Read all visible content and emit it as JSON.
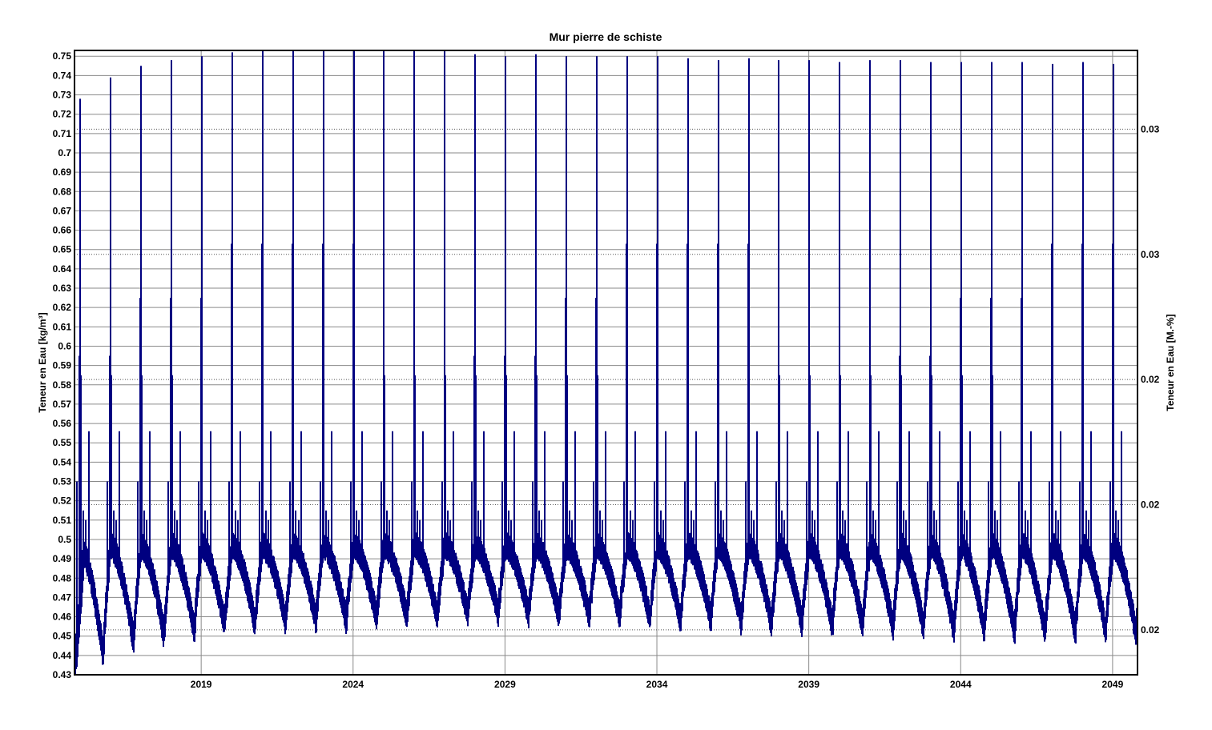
{
  "chart_data": {
    "type": "line",
    "title": "Mur pierre de schiste",
    "ylabel": "Teneur en Eau [kg/m³]",
    "ylabel_right": "Teneur en Eau [M.-%]",
    "xlabel": "",
    "xlim": [
      2014.83,
      2049.82
    ],
    "ylim": [
      0.43,
      0.753
    ],
    "grid": true,
    "series_color": "#000080",
    "x_ticks": [
      2019,
      2024,
      2029,
      2034,
      2039,
      2044,
      2049
    ],
    "y_ticks": [
      0.43,
      0.44,
      0.45,
      0.46,
      0.47,
      0.48,
      0.49,
      0.5,
      0.51,
      0.52,
      0.53,
      0.54,
      0.55,
      0.56,
      0.57,
      0.58,
      0.59,
      0.6,
      0.61,
      0.62,
      0.63,
      0.64,
      0.65,
      0.66,
      0.67,
      0.68,
      0.69,
      0.7,
      0.71,
      0.72,
      0.73,
      0.74,
      0.75
    ],
    "y_tick_labels": [
      "0.43",
      "0.44",
      "0.45",
      "0.46",
      "0.47",
      "0.48",
      "0.49",
      "0.5",
      "0.51",
      "0.52",
      "0.53",
      "0.54",
      "0.55",
      "0.56",
      "0.57",
      "0.58",
      "0.59",
      "0.6",
      "0.61",
      "0.62",
      "0.63",
      "0.64",
      "0.65",
      "0.66",
      "0.67",
      "0.68",
      "0.69",
      "0.7",
      "0.71",
      "0.72",
      "0.73",
      "0.74",
      "0.75"
    ],
    "right_axis": {
      "kgm3_per_mpercent": 25.9,
      "ticks": [
        0.0175,
        0.02,
        0.0225,
        0.025,
        0.0275
      ],
      "labels": [
        "0.02",
        "0.02",
        "0.02",
        "0.03",
        "0.03"
      ]
    },
    "series": [
      {
        "name": "Teneur en Eau",
        "start_value": 0.43,
        "annual_peak_years": [
          2015,
          2016,
          2017,
          2018,
          2019,
          2020,
          2021,
          2022,
          2023,
          2024,
          2025,
          2026,
          2027,
          2028,
          2029,
          2030,
          2031,
          2032,
          2033,
          2034,
          2035,
          2036,
          2037,
          2038,
          2039,
          2040,
          2041,
          2042,
          2043,
          2044,
          2045,
          2046,
          2047,
          2048,
          2049
        ],
        "annual_peak_values": [
          0.728,
          0.739,
          0.745,
          0.748,
          0.75,
          0.752,
          0.753,
          0.753,
          0.753,
          0.753,
          0.753,
          0.753,
          0.753,
          0.751,
          0.75,
          0.751,
          0.75,
          0.75,
          0.75,
          0.75,
          0.749,
          0.748,
          0.749,
          0.748,
          0.748,
          0.747,
          0.748,
          0.748,
          0.747,
          0.747,
          0.747,
          0.747,
          0.746,
          0.747,
          0.746
        ],
        "secondary_peak_value": 0.653,
        "winter_plateau_value": 0.497,
        "annual_min_years": [
          2015,
          2016,
          2017,
          2018,
          2019,
          2020,
          2021,
          2022,
          2023,
          2024,
          2025,
          2026,
          2027,
          2028,
          2029,
          2030,
          2031,
          2032,
          2033,
          2034,
          2035,
          2036,
          2037,
          2038,
          2039,
          2040,
          2041,
          2042,
          2043,
          2044,
          2045,
          2046,
          2047,
          2048,
          2049
        ],
        "annual_min_values": [
          0.44,
          0.447,
          0.45,
          0.453,
          0.455,
          0.456,
          0.457,
          0.458,
          0.458,
          0.459,
          0.46,
          0.46,
          0.461,
          0.461,
          0.461,
          0.461,
          0.46,
          0.46,
          0.459,
          0.458,
          0.458,
          0.457,
          0.456,
          0.456,
          0.455,
          0.455,
          0.454,
          0.454,
          0.453,
          0.453,
          0.452,
          0.452,
          0.452,
          0.452,
          0.451
        ]
      }
    ]
  }
}
